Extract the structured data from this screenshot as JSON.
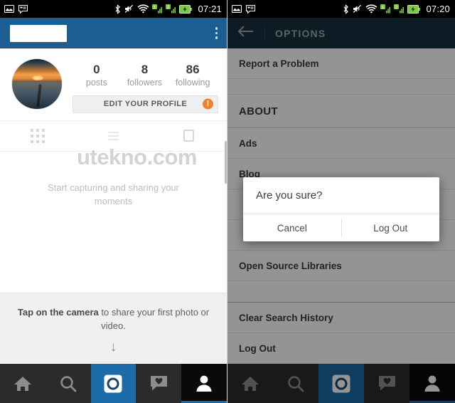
{
  "left": {
    "statusbar": {
      "icons": [
        "image-icon",
        "sms-icon",
        "bluetooth-icon",
        "mute-icon",
        "wifi-icon",
        "signal-sim1-icon",
        "signal-sim2-icon",
        "battery-charging-icon"
      ],
      "clock": "07:21"
    },
    "appbar": {
      "username_redacted": "",
      "overflow_label": "More options"
    },
    "profile": {
      "avatar_alt": "sunset-over-water-avatar",
      "stats": [
        {
          "num": "0",
          "label": "posts"
        },
        {
          "num": "8",
          "label": "followers"
        },
        {
          "num": "86",
          "label": "following"
        }
      ],
      "edit_button": "EDIT YOUR PROFILE",
      "warning_badge": "!"
    },
    "tabs": [
      {
        "name": "grid-view",
        "icon": "grid-icon"
      },
      {
        "name": "list-view",
        "icon": "list-icon"
      },
      {
        "name": "photos-of-you",
        "icon": "tag-icon"
      }
    ],
    "watermark": "utekno.com",
    "empty_state": "Start capturing and sharing your moments",
    "banner": {
      "bold": "Tap on the camera",
      "rest": " to share your first photo or video.",
      "arrow": "↓"
    }
  },
  "right": {
    "statusbar": {
      "clock": "07:20"
    },
    "appbar": {
      "back": "←",
      "title": "OPTIONS"
    },
    "menu_top": [
      {
        "label": "Report a Problem"
      }
    ],
    "section": {
      "label": "ABOUT"
    },
    "menu_about": [
      {
        "label": "Ads"
      },
      {
        "label": "Blog"
      },
      {
        "label": "Open Source Libraries"
      }
    ],
    "menu_bottom": [
      {
        "label": "Clear Search History"
      },
      {
        "label": "Log Out"
      }
    ],
    "dialog": {
      "title": "Are you sure?",
      "cancel": "Cancel",
      "confirm": "Log Out"
    }
  },
  "bottomnav": [
    {
      "name": "home",
      "icon": "home-icon"
    },
    {
      "name": "search",
      "icon": "search-icon"
    },
    {
      "name": "camera",
      "icon": "camera-icon"
    },
    {
      "name": "activity",
      "icon": "heart-icon"
    },
    {
      "name": "profile",
      "icon": "person-icon"
    }
  ],
  "colors": {
    "brand_blue": "#1b6ca8",
    "appbar_blue": "#1b5e8f",
    "appbar_dark": "#16303f",
    "badge_orange": "#f0812a"
  }
}
